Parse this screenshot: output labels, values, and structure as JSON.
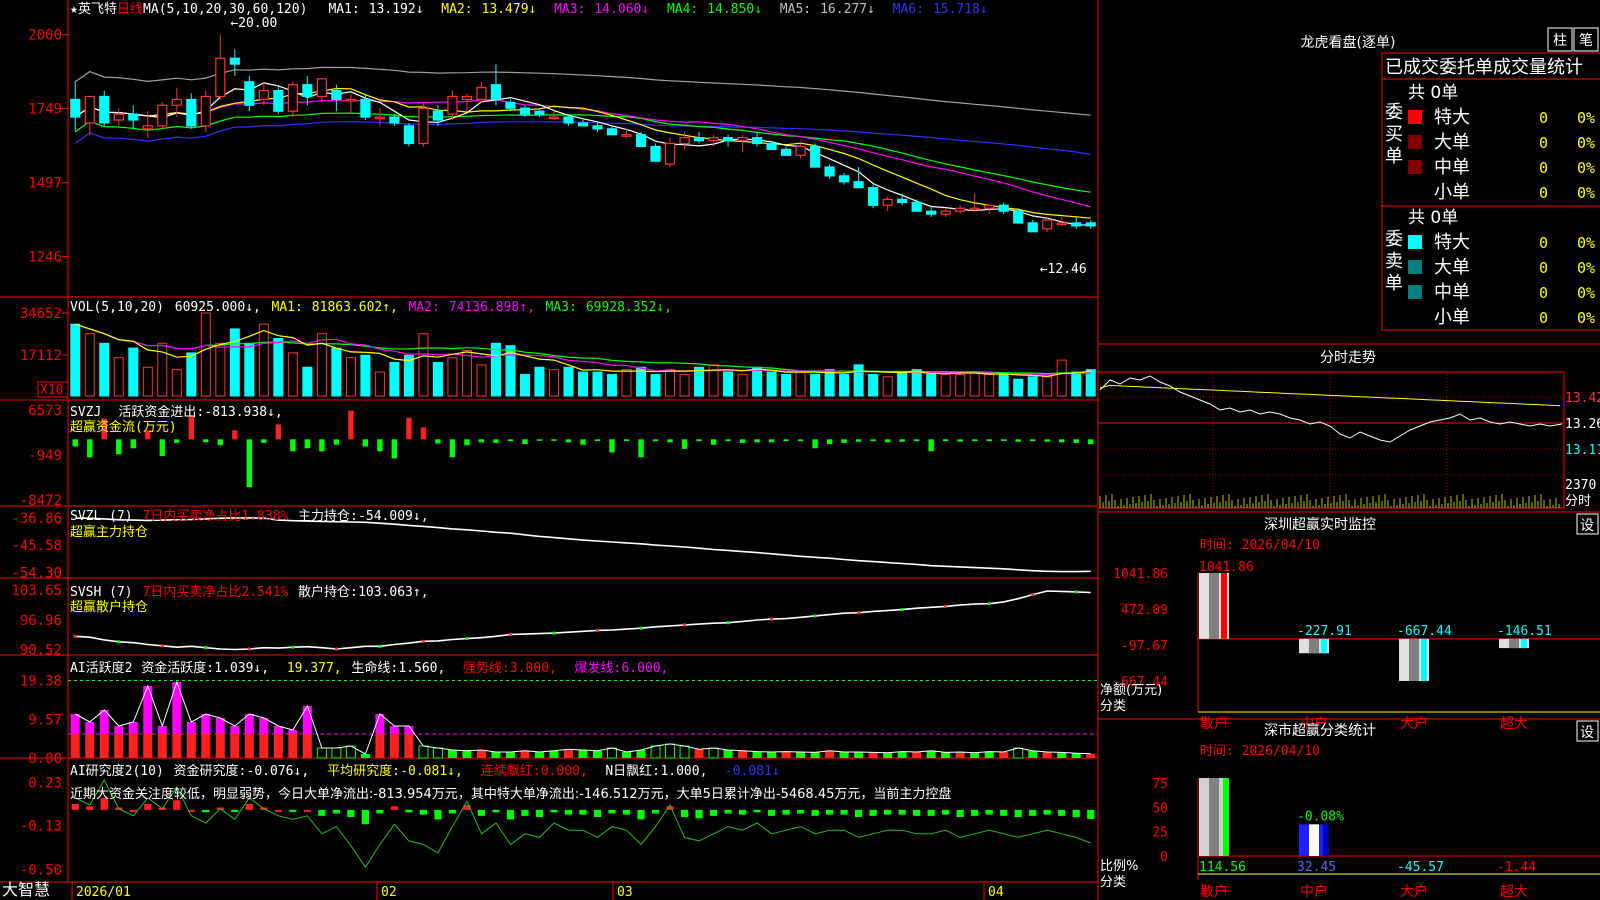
{
  "app": {
    "name": "大智慧"
  },
  "stock": {
    "name": "英飞特",
    "period": "日线"
  },
  "colors": {
    "up": "#ff3232",
    "down": "#00ffff",
    "grid": "#ff0000",
    "white": "#ffffff",
    "yellow": "#ffff00",
    "magenta": "#ff00ff",
    "green": "#00ff00",
    "blue": "#3030ff",
    "gray": "#b0b0b0",
    "buyGreen": "#00ff00",
    "redBar": "#ff2020"
  },
  "main": {
    "ma_label": "MA(5,10,20,30,60,120)",
    "ma_items": [
      {
        "name": "MA1:",
        "value": "13.192↓",
        "color": "#ffffff"
      },
      {
        "name": "MA2:",
        "value": "13.479↓",
        "color": "#ffff00"
      },
      {
        "name": "MA3:",
        "value": "14.060↓",
        "color": "#ff00ff"
      },
      {
        "name": "MA4:",
        "value": "14.850↓",
        "color": "#00ff00"
      },
      {
        "name": "MA5:",
        "value": "16.277↓",
        "color": "#c0c0c0"
      },
      {
        "name": "MA6:",
        "value": "15.718↓",
        "color": "#3030ff"
      }
    ],
    "high_label": "20.00",
    "low_label": "12.46",
    "y_ticks": [
      "2000",
      "1749",
      "1497",
      "1246"
    ]
  },
  "vol": {
    "label": "VOL(5,10,20)",
    "value": "60925.000↓",
    "items": [
      {
        "name": "MA1:",
        "value": "81863.602↑",
        "color": "#ffff00"
      },
      {
        "name": "MA2:",
        "value": "74136.898↑",
        "color": "#ff00ff"
      },
      {
        "name": "MA3:",
        "value": "69928.352↓",
        "color": "#00ff00"
      }
    ],
    "y_ticks": [
      "34652",
      "17112"
    ],
    "unit": "X10"
  },
  "svzj": {
    "label": "SVZJ",
    "title": "活跃资金进出:",
    "value": "-813.938↓,",
    "sub": "超赢资金流(万元)",
    "y_ticks": [
      "6573",
      "-949",
      "-8472"
    ]
  },
  "svzl": {
    "label": "SVZL (7)",
    "ratio": "7日内买卖净占比1.838%",
    "title": "主力持仓:",
    "value": "-54.009↓,",
    "sub": "超赢主力持仓",
    "y_ticks": [
      "-36.86",
      "-45.58",
      "-54.30"
    ]
  },
  "svsh": {
    "label": "SVSH (7)",
    "ratio": "7日内买卖净占比2.541%",
    "title": "散户持仓:",
    "value": "103.063↑,",
    "sub": "超赢散户持仓",
    "y_ticks": [
      "103.65",
      "96.96",
      "90.52"
    ]
  },
  "ai1": {
    "label": "AI活跃度2",
    "title": "资金活跃度:",
    "value": "1.039↓,",
    "v2": "19.377",
    "life": "生命线:",
    "life_val": "1.560,",
    "strong": "强势线:",
    "strong_val": "3.000,",
    "burst": "爆发线:",
    "burst_val": "6.000,",
    "y_ticks": [
      "19.38",
      "9.57",
      "0.00"
    ]
  },
  "ai2": {
    "label": "AI研究度2(10)",
    "title": "资金研究度:",
    "value": "-0.076↓,",
    "avg": "平均研究度:",
    "avg_val": "-0.081↓,",
    "cont": "连续飘红:",
    "cont_val": "0.000,",
    "nday": "N日飘红:",
    "nday_val": "1.000,",
    "last": "-0.081↓",
    "comment": "近期大资金关注度较低，明显弱势，今日大单净流出:-813.954万元，其中特大单净流出:-146.512万元，大单5日累计净出-5468.45万元，当前主力控盘",
    "y_ticks": [
      "0.23",
      "-0.13",
      "-0.50"
    ]
  },
  "xaxis": {
    "labels": [
      "2026/01",
      "02",
      "03",
      "04"
    ]
  },
  "longhu": {
    "title": "龙虎看盘(逐单)",
    "btn1": "柱",
    "btn2": "笔",
    "tabs": "已成交委托单成交量统计",
    "buy_label": "委买单",
    "sell_label": "委卖单",
    "buy_total": "共 0单",
    "sell_total": "共 0单",
    "rows": [
      {
        "name": "特大",
        "val": "0",
        "pct": "0%"
      },
      {
        "name": "大单",
        "val": "0",
        "pct": "0%"
      },
      {
        "name": "中单",
        "val": "0",
        "pct": "0%"
      },
      {
        "name": "小单",
        "val": "0",
        "pct": "0%"
      }
    ],
    "buy_colors": [
      "#ff0000",
      "#800000",
      "#800000",
      ""
    ],
    "sell_colors": [
      "#00ffff",
      "#008080",
      "#008080",
      ""
    ]
  },
  "fenshi": {
    "title": "分时走势",
    "prices": [
      "13.42",
      "13.26",
      "13.11"
    ],
    "vol": "2370",
    "vol_unit": "分时"
  },
  "monitor": {
    "title": "深圳超赢实时监控",
    "set": "设",
    "time": "时间: 2026/04/10",
    "y_ticks": [
      "1041.86",
      "472.09",
      "-97.67",
      "-667.44"
    ],
    "ylabel1": "净额(万元)",
    "ylabel2": "分类",
    "bars": [
      {
        "cat": "散户",
        "value": 1041.86,
        "label": "1041.86"
      },
      {
        "cat": "中户",
        "value": -227.91,
        "label": "-227.91"
      },
      {
        "cat": "大户",
        "value": -667.44,
        "label": "-667.44"
      },
      {
        "cat": "超大",
        "value": -146.51,
        "label": "-146.51"
      }
    ]
  },
  "classify": {
    "title": "深市超赢分类统计",
    "set": "设",
    "time": "时间: 2026/04/10",
    "y_ticks": [
      "75",
      "50",
      "25",
      "0"
    ],
    "ylabel1": "比例%",
    "ylabel2": "分类",
    "bars": [
      {
        "cat": "散户",
        "value": 114.56,
        "label": "114.56"
      },
      {
        "cat": "中户",
        "value": 32.45,
        "label": "32.45",
        "top_label": "-0.08%"
      },
      {
        "cat": "大户",
        "value": -45.57,
        "label": "-45.57"
      },
      {
        "cat": "超大",
        "value": -1.44,
        "label": "-1.44"
      }
    ]
  },
  "chart_data": [
    {
      "type": "candlestick",
      "title": "英飞特 日线",
      "ma_params": [
        5,
        10,
        20,
        30,
        60,
        120
      ],
      "ma_last": {
        "MA1": 13.192,
        "MA2": 13.479,
        "MA3": 14.06,
        "MA4": 14.85,
        "MA5": 16.277,
        "MA6": 15.718
      },
      "ylim": [
        12.0,
        20.5
      ],
      "high": 20.0,
      "low": 12.46,
      "ohlc": [
        [
          17.8,
          18.4,
          16.7,
          17.2
        ],
        [
          17.0,
          17.9,
          16.6,
          17.9
        ],
        [
          17.9,
          18.1,
          16.9,
          17.0
        ],
        [
          17.1,
          17.5,
          16.9,
          17.3
        ],
        [
          17.3,
          17.6,
          16.8,
          17.1
        ],
        [
          16.8,
          17.4,
          16.5,
          16.9
        ],
        [
          16.9,
          17.7,
          16.8,
          17.6
        ],
        [
          17.6,
          18.2,
          17.2,
          17.8
        ],
        [
          17.8,
          18.0,
          16.8,
          16.9
        ],
        [
          16.9,
          18.1,
          16.7,
          17.9
        ],
        [
          17.9,
          20.0,
          17.8,
          19.2
        ],
        [
          19.2,
          19.5,
          18.6,
          19.0
        ],
        [
          18.4,
          18.6,
          17.4,
          17.6
        ],
        [
          17.8,
          18.4,
          17.6,
          18.1
        ],
        [
          18.1,
          18.3,
          17.3,
          17.4
        ],
        [
          17.4,
          18.4,
          17.2,
          18.3
        ],
        [
          18.3,
          18.6,
          17.6,
          17.9
        ],
        [
          17.9,
          18.5,
          17.7,
          18.5
        ],
        [
          18.1,
          18.3,
          17.4,
          17.8
        ],
        [
          17.8,
          18.0,
          17.3,
          17.8
        ],
        [
          17.8,
          18.0,
          17.1,
          17.2
        ],
        [
          17.2,
          17.5,
          16.9,
          17.2
        ],
        [
          17.2,
          17.3,
          16.9,
          17.0
        ],
        [
          16.9,
          17.0,
          16.2,
          16.3
        ],
        [
          16.3,
          17.7,
          16.2,
          17.5
        ],
        [
          17.4,
          17.6,
          16.9,
          17.1
        ],
        [
          17.3,
          18.1,
          17.1,
          17.9
        ],
        [
          17.8,
          18.0,
          17.4,
          17.9
        ],
        [
          17.8,
          18.4,
          17.7,
          18.2
        ],
        [
          18.3,
          19.0,
          17.6,
          17.8
        ],
        [
          17.7,
          17.8,
          17.4,
          17.5
        ],
        [
          17.5,
          17.6,
          17.2,
          17.3
        ],
        [
          17.4,
          17.5,
          17.2,
          17.3
        ],
        [
          17.2,
          17.4,
          17.1,
          17.2
        ],
        [
          17.2,
          17.3,
          16.9,
          17.0
        ],
        [
          17.0,
          17.1,
          16.9,
          16.9
        ],
        [
          16.9,
          17.0,
          16.7,
          16.8
        ],
        [
          16.8,
          16.9,
          16.6,
          16.6
        ],
        [
          16.6,
          16.8,
          16.5,
          16.6
        ],
        [
          16.6,
          16.7,
          16.2,
          16.2
        ],
        [
          16.2,
          16.3,
          15.7,
          15.7
        ],
        [
          15.6,
          16.5,
          15.5,
          16.3
        ],
        [
          16.3,
          16.7,
          16.1,
          16.5
        ],
        [
          16.5,
          16.7,
          16.3,
          16.4
        ],
        [
          16.4,
          16.6,
          16.2,
          16.5
        ],
        [
          16.5,
          16.6,
          16.2,
          16.4
        ],
        [
          16.4,
          16.6,
          16.0,
          16.5
        ],
        [
          16.5,
          16.7,
          16.2,
          16.3
        ],
        [
          16.3,
          16.4,
          16.1,
          16.1
        ],
        [
          16.1,
          16.2,
          15.9,
          15.9
        ],
        [
          15.9,
          16.3,
          15.8,
          16.2
        ],
        [
          16.2,
          16.3,
          15.5,
          15.5
        ],
        [
          15.5,
          15.6,
          15.1,
          15.2
        ],
        [
          15.2,
          15.3,
          14.9,
          15.0
        ],
        [
          15.0,
          15.5,
          14.8,
          14.8
        ],
        [
          14.8,
          14.9,
          14.1,
          14.2
        ],
        [
          14.2,
          14.5,
          14.0,
          14.4
        ],
        [
          14.4,
          14.6,
          14.2,
          14.3
        ],
        [
          14.3,
          14.4,
          14.0,
          14.0
        ],
        [
          14.0,
          14.2,
          13.8,
          13.9
        ],
        [
          13.9,
          14.1,
          13.8,
          14.0
        ],
        [
          14.0,
          14.2,
          13.9,
          14.1
        ],
        [
          14.1,
          14.6,
          14.0,
          14.1
        ],
        [
          14.1,
          14.2,
          13.9,
          14.2
        ],
        [
          14.2,
          14.3,
          13.9,
          14.0
        ],
        [
          14.0,
          14.1,
          13.6,
          13.6
        ],
        [
          13.6,
          13.7,
          13.3,
          13.3
        ],
        [
          13.4,
          13.8,
          13.3,
          13.7
        ],
        [
          13.6,
          13.8,
          13.5,
          13.6
        ],
        [
          13.6,
          13.8,
          13.4,
          13.5
        ],
        [
          13.6,
          13.7,
          13.4,
          13.5
        ]
      ]
    },
    {
      "type": "bar",
      "title": "VOL(5,10,20)",
      "unit": "X10",
      "ylim": [
        0,
        38000
      ],
      "values": [
        30000,
        26000,
        22000,
        16000,
        20000,
        12000,
        22000,
        11000,
        18000,
        34652,
        22000,
        28000,
        22000,
        30000,
        24000,
        18000,
        12000,
        26000,
        20000,
        16000,
        17000,
        10000,
        14000,
        17000,
        26000,
        14000,
        16000,
        19000,
        13000,
        22000,
        21000,
        9000,
        12000,
        11000,
        12000,
        10000,
        10000,
        9000,
        11000,
        12000,
        9000,
        11000,
        9000,
        12000,
        13000,
        10000,
        9000,
        12000,
        10000,
        9000,
        10000,
        9000,
        11000,
        9000,
        13000,
        9000,
        8000,
        10000,
        11000,
        9000,
        9000,
        9000,
        10000,
        9000,
        9000,
        7000,
        8000,
        8000,
        15000,
        10000,
        11000,
        10000
      ],
      "ma": {
        "MA1": 81863.602,
        "MA2": 74136.898,
        "MA3": 69928.352
      }
    },
    {
      "type": "bar",
      "title": "超赢资金流(万元)",
      "ylim": [
        -8472,
        6573
      ],
      "values": [
        -1200,
        -3000,
        3500,
        -2500,
        -1500,
        1500,
        -2800,
        -600,
        4000,
        -500,
        -1000,
        1500,
        -8000,
        -600,
        2500,
        -2000,
        -1500,
        -2000,
        -900,
        4800,
        -1200,
        -2000,
        -3200,
        3600,
        2000,
        -700,
        -3000,
        -1000,
        -500,
        -600,
        -300,
        -800,
        -200,
        -200,
        -500,
        -900,
        -300,
        -2200,
        -300,
        -3000,
        -300,
        -500,
        -1600,
        -300,
        -900,
        -300,
        -600,
        -500,
        -500,
        -300,
        -300,
        -1500,
        -800,
        -600,
        -400,
        -300,
        -500,
        -400,
        -300,
        -2000,
        -300,
        -400,
        -300,
        -300,
        -300,
        -400,
        -300,
        -400,
        -500,
        -600,
        -813.938
      ]
    },
    {
      "type": "line",
      "title": "超赢主力持仓",
      "ylim": [
        -55.5,
        -35.0
      ],
      "values": [
        -37.0,
        -37.0,
        -37.2,
        -37.5,
        -37.6,
        -37.7,
        -37.6,
        -37.5,
        -37.4,
        -37.2,
        -37.0,
        -36.9,
        -36.9,
        -37.0,
        -37.6,
        -37.8,
        -37.9,
        -38.0,
        -38.1,
        -38.2,
        -38.3,
        -38.6,
        -38.9,
        -39.3,
        -39.6,
        -40.0,
        -40.4,
        -40.7,
        -41.1,
        -41.5,
        -41.8,
        -42.3,
        -42.8,
        -43.2,
        -43.6,
        -44.0,
        -44.3,
        -44.6,
        -44.9,
        -45.2,
        -45.6,
        -45.9,
        -46.2,
        -46.6,
        -47.0,
        -47.3,
        -47.7,
        -48.0,
        -48.4,
        -48.8,
        -49.2,
        -49.5,
        -49.8,
        -50.2,
        -50.6,
        -50.9,
        -51.2,
        -51.5,
        -51.8,
        -52.2,
        -52.4,
        -52.6,
        -52.8,
        -53.0,
        -53.2,
        -53.5,
        -53.8,
        -54.0,
        -54.1,
        -54.1,
        -54.009
      ]
    },
    {
      "type": "line",
      "title": "超赢散户持仓",
      "ylim": [
        89.5,
        104.5
      ],
      "values": [
        93.4,
        93.2,
        92.6,
        92.2,
        92.0,
        91.6,
        91.3,
        91.0,
        91.2,
        90.9,
        90.6,
        90.5,
        90.6,
        90.9,
        90.8,
        91.0,
        91.1,
        90.9,
        90.6,
        90.9,
        91.2,
        91.2,
        91.6,
        91.9,
        92.3,
        92.4,
        92.7,
        92.9,
        93.1,
        93.4,
        93.8,
        93.9,
        94.0,
        94.1,
        94.3,
        94.5,
        94.7,
        94.8,
        95.0,
        95.2,
        95.5,
        95.7,
        95.9,
        96.1,
        96.3,
        96.4,
        96.7,
        97.0,
        97.2,
        97.3,
        97.6,
        97.9,
        98.2,
        98.5,
        98.6,
        98.9,
        99.1,
        99.3,
        99.6,
        99.8,
        100.0,
        100.3,
        100.5,
        100.6,
        101.0,
        101.7,
        102.6,
        103.4,
        103.3,
        103.2,
        103.063
      ]
    },
    {
      "type": "bar",
      "title": "AI活跃度2",
      "ylim": [
        0,
        20.5
      ],
      "lines": {
        "strong": 3.0,
        "burst": 6.0,
        "life": 1.56
      },
      "values": [
        11,
        9,
        12,
        8,
        9,
        18,
        8,
        19,
        9,
        11,
        10,
        8,
        11,
        10,
        8,
        7,
        13,
        2.5,
        2.5,
        3,
        1,
        11,
        8,
        8,
        3,
        2.5,
        2,
        1.8,
        2,
        1.5,
        1.5,
        1.8,
        1.5,
        1.8,
        2.2,
        2,
        1.8,
        2.5,
        1.5,
        2,
        3,
        3.5,
        3,
        2.2,
        2.5,
        2,
        1.8,
        1.6,
        1.5,
        1.6,
        1.5,
        1.4,
        1.8,
        1.5,
        1.5,
        1.4,
        1.3,
        1.6,
        1.5,
        1.8,
        1.4,
        1.5,
        1.3,
        1.6,
        1.5,
        2.5,
        1.8,
        1.5,
        1.4,
        1.2,
        1.039
      ]
    },
    {
      "type": "bar",
      "title": "AI研究度2(10)",
      "ylim": [
        -0.52,
        0.25
      ],
      "values": [
        0.05,
        0.03,
        0.1,
        0.02,
        0.0,
        0.05,
        0.02,
        0.08,
        0.0,
        -0.02,
        0.02,
        -0.01,
        0.05,
        0.02,
        0.0,
        -0.01,
        0.0,
        -0.05,
        -0.03,
        -0.06,
        -0.12,
        -0.03,
        0.03,
        -0.02,
        -0.04,
        -0.08,
        -0.03,
        0.04,
        -0.05,
        -0.02,
        -0.08,
        -0.05,
        -0.06,
        -0.02,
        -0.04,
        -0.04,
        -0.06,
        -0.03,
        -0.04,
        -0.08,
        -0.03,
        0.03,
        -0.06,
        -0.07,
        -0.05,
        -0.03,
        -0.04,
        -0.02,
        -0.05,
        -0.04,
        -0.03,
        -0.05,
        -0.04,
        -0.04,
        -0.06,
        -0.05,
        -0.04,
        -0.04,
        -0.05,
        -0.05,
        -0.04,
        -0.06,
        -0.05,
        -0.04,
        -0.05,
        -0.06,
        -0.05,
        -0.04,
        -0.05,
        -0.06,
        -0.076
      ]
    },
    {
      "type": "bar",
      "title": "深圳超赢实时监控",
      "ylabel": "净额(万元)",
      "ylim": [
        -667.44,
        1041.86
      ],
      "categories": [
        "散户",
        "中户",
        "大户",
        "超大"
      ],
      "values": [
        1041.86,
        -227.91,
        -667.44,
        -146.51
      ]
    },
    {
      "type": "bar",
      "title": "深市超赢分类统计",
      "ylabel": "比例%",
      "ylim": [
        0,
        75
      ],
      "categories": [
        "散户",
        "中户",
        "大户",
        "超大"
      ],
      "values": [
        114.56,
        32.45,
        -45.57,
        -1.44
      ]
    }
  ]
}
